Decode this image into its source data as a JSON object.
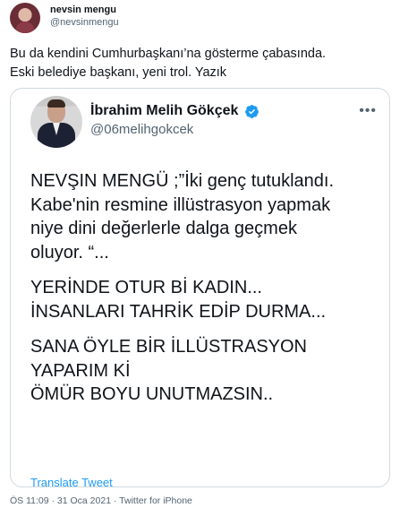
{
  "tweet": {
    "author_name": "nevsin mengu",
    "author_handle": "@nevsinmengu",
    "text_lines": [
      "Bu da kendini Cumhurbaşkanı’na gösterme çabasında.",
      "Eski belediye başkanı, yeni trol. Yazık"
    ],
    "timestamp": "ÖS 11:09 · 31 Oca 2021 · Twitter for iPhone"
  },
  "quoted": {
    "author_name": "İbrahim Melih Gökçek",
    "author_handle": "@06melihgokcek",
    "more_label": "•••",
    "text_blocks": [
      [
        "NEVŞIN MENGÜ ;”İki genç tutuklandı.",
        "Kabe'nin resmine illüstrasyon yapmak",
        "niye dini değerlerle dalga geçmek",
        "oluyor. “..."
      ],
      [
        "YERİNDE OTUR Bİ KADIN...",
        "İNSANLARI TAHRİK EDİP DURMA..."
      ],
      [
        "SANA ÖYLE BİR İLLÜSTRASYON",
        "YAPARIM Kİ",
        "ÖMÜR BOYU UNUTMAZSIN.."
      ]
    ],
    "translate_label": "Translate Tweet"
  },
  "colors": {
    "accent": "#1d9bf0",
    "muted": "#536471",
    "border": "#cfd9de"
  }
}
